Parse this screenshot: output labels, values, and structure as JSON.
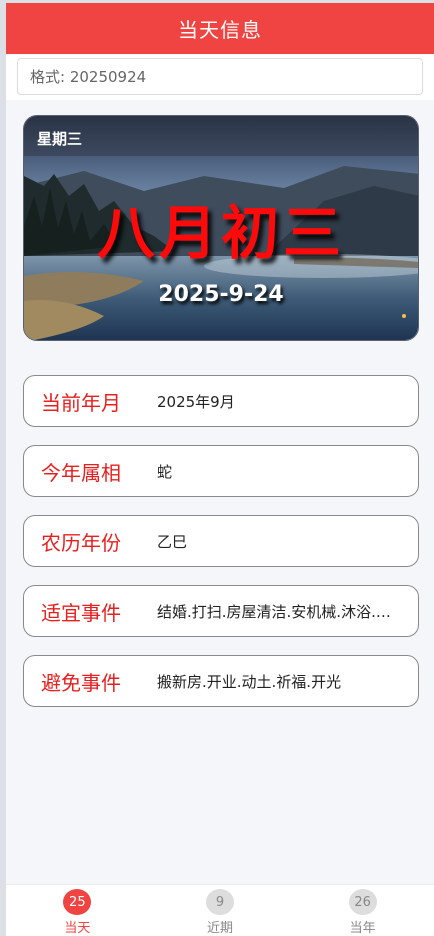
{
  "header": {
    "title": "当天信息"
  },
  "search": {
    "placeholder": "格式: 20250924",
    "value": ""
  },
  "hero": {
    "weekday": "星期三",
    "lunar_date": "八月初三",
    "solar_date": "2025-9-24"
  },
  "info_rows": [
    {
      "label": "当前年月",
      "value": "2025年9月"
    },
    {
      "label": "今年属相",
      "value": "蛇"
    },
    {
      "label": "农历年份",
      "value": "乙巳"
    },
    {
      "label": "适宜事件",
      "value": "结婚.打扫.房屋清洁.安机械.沐浴.会亲友"
    },
    {
      "label": "避免事件",
      "value": "搬新房.开业.动土.祈福.开光"
    }
  ],
  "tabbar": {
    "tabs": [
      {
        "badge": "25",
        "label": "当天",
        "active": true
      },
      {
        "badge": "9",
        "label": "近期",
        "active": false
      },
      {
        "badge": "26",
        "label": "当年",
        "active": false
      }
    ]
  },
  "colors": {
    "accent": "#ef4441",
    "label_red": "#e81f1f",
    "lunar_red": "#ff0a0a"
  }
}
